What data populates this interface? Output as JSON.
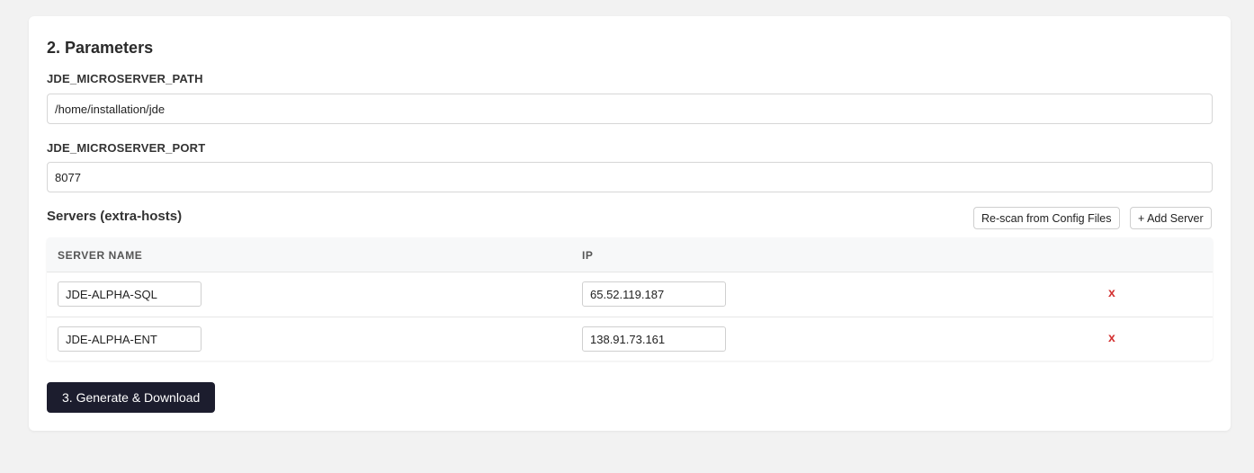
{
  "section": {
    "title": "2. Parameters"
  },
  "fields": {
    "path_label": "JDE_MICROSERVER_PATH",
    "path_value": "/home/installation/jde",
    "port_label": "JDE_MICROSERVER_PORT",
    "port_value": "8077"
  },
  "servers": {
    "title": "Servers (extra-hosts)",
    "rescan_label": "Re-scan from Config Files",
    "add_label": "+ Add Server",
    "columns": [
      "SERVER NAME",
      "IP"
    ],
    "rows": [
      {
        "name": "JDE-ALPHA-SQL",
        "ip": "65.52.119.187",
        "remove": "x"
      },
      {
        "name": "JDE-ALPHA-ENT",
        "ip": "138.91.73.161",
        "remove": "x"
      }
    ]
  },
  "actions": {
    "generate_label": "3. Generate & Download"
  },
  "colors": {
    "primary_button": "#1c1d2e",
    "remove_accent": "#d32f2f",
    "page_background": "#f2f2f2"
  }
}
